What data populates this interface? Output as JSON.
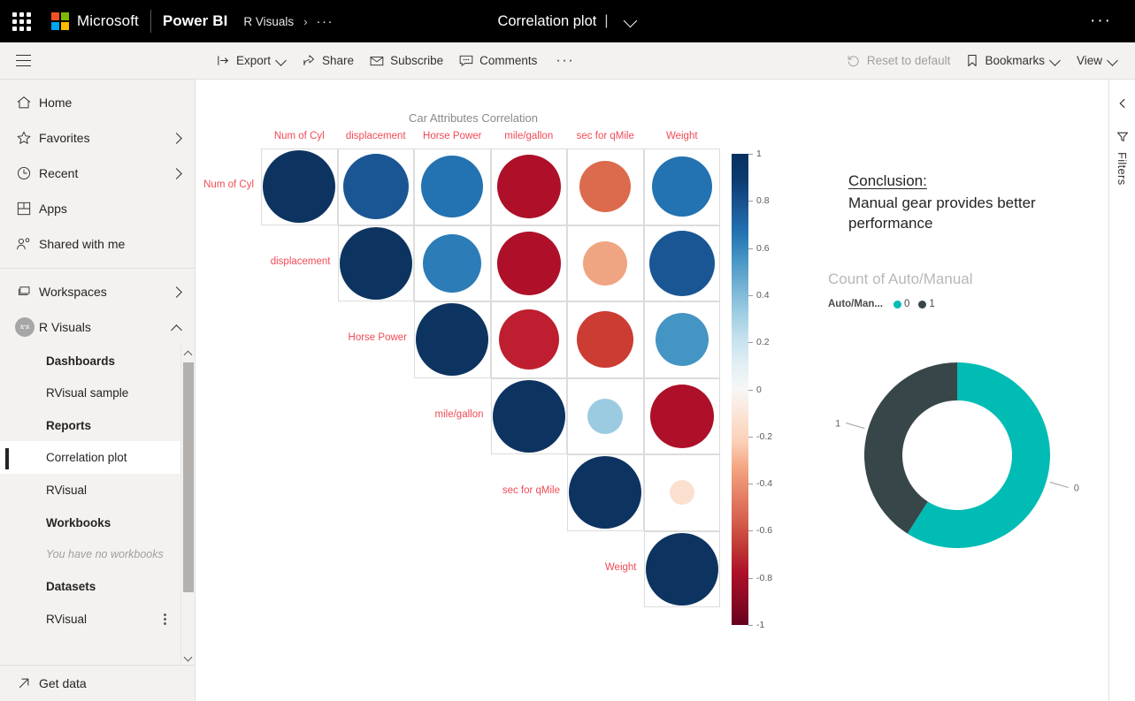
{
  "topbar": {
    "waffle_icon": "app-launcher-icon",
    "brand": "Microsoft",
    "product": "Power BI",
    "breadcrumb_workspace": "R Visuals",
    "breadcrumb_sep": "›",
    "breadcrumb_more": "···",
    "doc_title": "Correlation plot",
    "doc_pipe": "|",
    "more_options": "···"
  },
  "commandbar": {
    "hamburger": "navigation-menu-icon",
    "export": "Export",
    "share": "Share",
    "subscribe": "Subscribe",
    "comments": "Comments",
    "more": "···",
    "reset_to_default": "Reset to default",
    "bookmarks": "Bookmarks",
    "view": "View"
  },
  "sidebar": {
    "primary": [
      {
        "label": "Home",
        "icon": "home-icon",
        "chevron": false
      },
      {
        "label": "Favorites",
        "icon": "star-icon",
        "chevron": true
      },
      {
        "label": "Recent",
        "icon": "clock-icon",
        "chevron": true
      },
      {
        "label": "Apps",
        "icon": "apps-icon",
        "chevron": false
      },
      {
        "label": "Shared with me",
        "icon": "people-icon",
        "chevron": false
      }
    ],
    "workspaces": {
      "label": "Workspaces",
      "icon": "workspaces-icon",
      "chevron": true
    },
    "current_workspace": {
      "label": "R Visuals",
      "icon": "workspace-avatar",
      "chevron": true
    },
    "sections": [
      {
        "type": "header",
        "label": "Dashboards"
      },
      {
        "type": "item",
        "label": "RVisual sample",
        "selected": false
      },
      {
        "type": "header",
        "label": "Reports"
      },
      {
        "type": "item",
        "label": "Correlation plot",
        "selected": true
      },
      {
        "type": "item",
        "label": "RVisual",
        "selected": false
      },
      {
        "type": "header",
        "label": "Workbooks"
      },
      {
        "type": "empty",
        "label": "You have no workbooks"
      },
      {
        "type": "header",
        "label": "Datasets"
      },
      {
        "type": "item-menu",
        "label": "RVisual",
        "selected": false,
        "menu_icon": "kebab-menu-icon"
      }
    ],
    "get_data": {
      "label": "Get data",
      "icon": "get-data-icon"
    }
  },
  "filters_rail": {
    "collapse_icon": "chevron-left-icon",
    "filter_icon": "filter-icon",
    "label": "Filters"
  },
  "report": {
    "conclusion_heading": "Conclusion:",
    "conclusion_text": "Manual gear provides better performance",
    "count_title": "Count of Auto/Manual",
    "legend_label": "Auto/Man...",
    "legend_items": [
      {
        "label": "0",
        "color": "#00bcb4"
      },
      {
        "label": "1",
        "color": "#374649"
      }
    ]
  },
  "chart_data": [
    {
      "type": "heatmap",
      "subtype": "correlation-matrix-circles",
      "title": "Car Attributes Correlation",
      "xlabel": "",
      "ylabel": "",
      "categories": [
        "Num of Cyl",
        "displacement",
        "Horse Power",
        "mile/gallon",
        "sec for qMile",
        "Weight"
      ],
      "colorbar": {
        "ticks": [
          "1",
          "0.8",
          "0.6",
          "0.4",
          "0.2",
          "0",
          "-0.2",
          "-0.4",
          "-0.6",
          "-0.8",
          "-1"
        ],
        "range": [
          -1,
          1
        ],
        "colormap": "RdBu",
        "high_color": "#053061",
        "mid_color": "#f7f7f7",
        "low_color": "#67001f"
      },
      "matrix": [
        [
          1.0,
          0.9,
          0.83,
          -0.85,
          -0.59,
          0.78
        ],
        [
          null,
          1.0,
          0.79,
          -0.85,
          -0.43,
          0.89
        ],
        [
          null,
          null,
          1.0,
          -0.78,
          -0.71,
          0.66
        ],
        [
          null,
          null,
          null,
          1.0,
          0.42,
          -0.87
        ],
        [
          null,
          null,
          null,
          null,
          1.0,
          -0.17
        ],
        [
          null,
          null,
          null,
          null,
          null,
          1.0
        ]
      ],
      "cell_colors": [
        [
          "#0d3360",
          "#1a5694",
          "#2372b1",
          "#ad1028",
          "#dc6b4d",
          "#2372b1"
        ],
        [
          null,
          "#0d3360",
          "#2c7cb8",
          "#ad1028",
          "#f0a582",
          "#1a5694"
        ],
        [
          null,
          null,
          "#0d3360",
          "#be1e2f",
          "#cb3c33",
          "#4494c4"
        ],
        [
          null,
          null,
          null,
          "#0d3360",
          "#9bcbe1",
          "#ad1028"
        ],
        [
          null,
          null,
          null,
          null,
          "#0d3360",
          "#fbe0cf"
        ],
        [
          null,
          null,
          null,
          null,
          null,
          "#0d3360"
        ]
      ],
      "cell_radius_px": [
        [
          41,
          37,
          35,
          36,
          29,
          34
        ],
        [
          null,
          41,
          33,
          36,
          25,
          37
        ],
        [
          null,
          null,
          41,
          34,
          32,
          30
        ],
        [
          null,
          null,
          null,
          41,
          20,
          36
        ],
        [
          null,
          null,
          null,
          null,
          41,
          14
        ],
        [
          null,
          null,
          null,
          null,
          null,
          41
        ]
      ],
      "grid": true,
      "label_color": "#f04b57"
    },
    {
      "type": "pie",
      "subtype": "donut",
      "title": "Count of Auto/Manual",
      "labels": [
        "0",
        "1"
      ],
      "values": [
        59,
        41
      ],
      "colors": [
        "#00bcb4",
        "#374649"
      ],
      "legend_position": "top"
    }
  ]
}
